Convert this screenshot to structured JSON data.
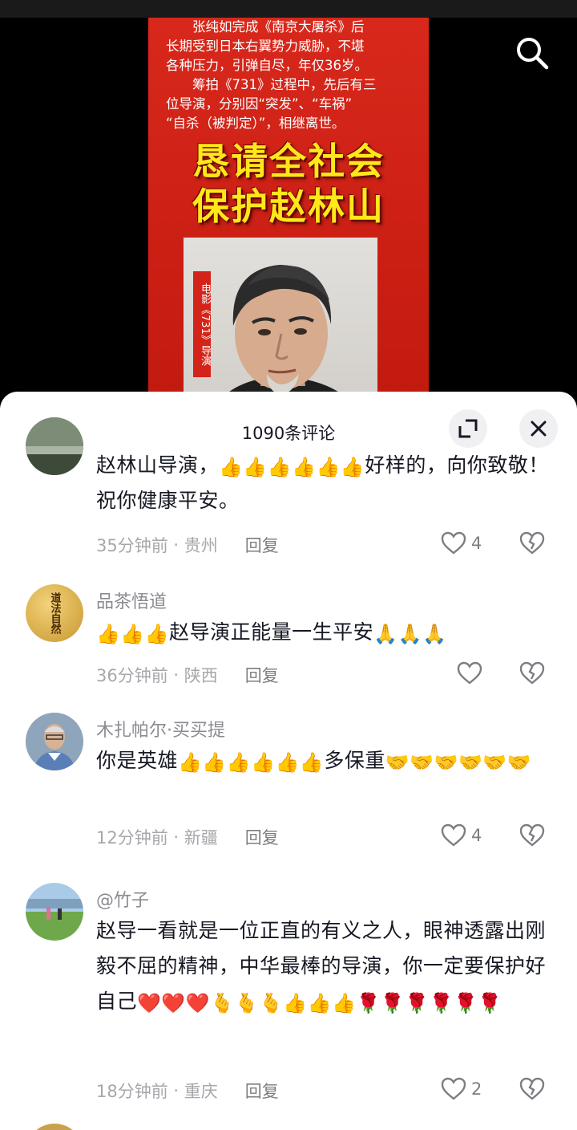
{
  "video": {
    "poster_lines": [
      "张纯如完成《南京大屠杀》后",
      "长期受到日本右翼势力威胁，不堪",
      "各种压力，引弹自尽，年仅36岁。",
      "筹拍《731》过程中，先后有三",
      "位导演，分别因“突发”、“车祸”",
      "“自杀（被判定）”，相继离世。"
    ],
    "slogan_line1": "恳请全社会",
    "slogan_line2": "保护赵林山",
    "photo_tag": "电影《731》导演"
  },
  "sheet": {
    "comment_count": "1090条评论",
    "icons": {
      "expand": "expand-icon",
      "close": "close-icon",
      "search": "search-icon"
    }
  },
  "comments": [
    {
      "username": "",
      "text_prefix": "赵林山导演，",
      "emoji_a": "👍👍👍👍👍👍",
      "text_suffix": "好样的，向你致敬！祝你健康平安。",
      "time": "35分钟前",
      "location": "贵州",
      "reply": "回复",
      "likes": "4"
    },
    {
      "username": "品茶悟道",
      "emoji_a": "👍👍👍",
      "text": "赵导演正能量一生平安",
      "emoji_b": "🙏🙏🙏",
      "time": "36分钟前",
      "location": "陕西",
      "reply": "回复",
      "likes": "",
      "avatar_text": "道法自然"
    },
    {
      "username": "木扎帕尔·买买提",
      "text": "你是英雄",
      "emoji_a": "👍👍👍👍👍👍",
      "text2": "多保重",
      "emoji_b": "🤝🤝🤝🤝🤝🤝",
      "time": "12分钟前",
      "location": "新疆",
      "reply": "回复",
      "likes": "4"
    },
    {
      "username": "@竹子",
      "text": "赵导一看就是一位正直的有义之人，眼神透露出刚毅不屈的精神，中华最棒的导演，你一定要保护好自己",
      "emoji_a": "❤️❤️❤️",
      "emoji_b": "🫰🫰🫰",
      "emoji_c": "👍👍👍",
      "emoji_d": "🌹🌹🌹🌹🌹🌹",
      "time": "18分钟前",
      "location": "重庆",
      "reply": "回复",
      "likes": "2"
    }
  ],
  "colors": {
    "poster_red": "#cc1f14",
    "slogan_yellow": "#ffe81a",
    "text": "#161823",
    "muted": "#a6a7ab"
  }
}
